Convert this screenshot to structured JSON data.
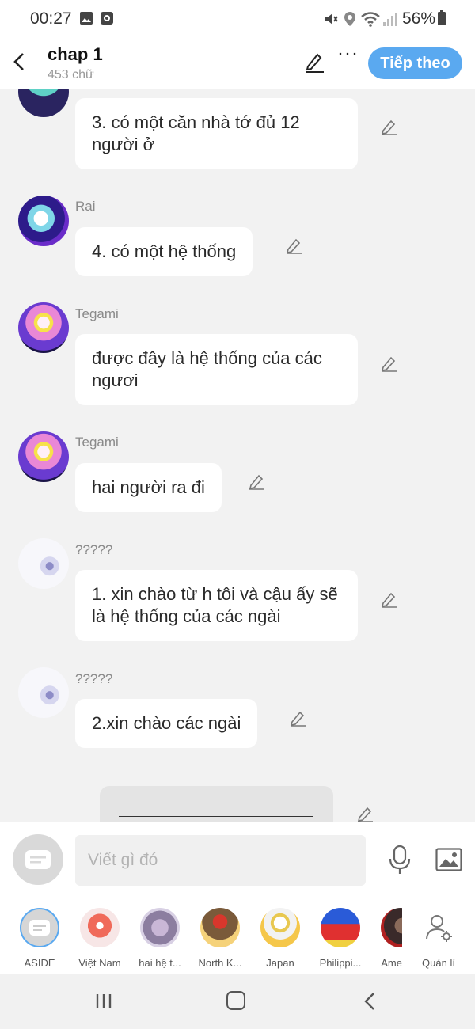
{
  "status_bar": {
    "time": "00:27",
    "battery": "56%"
  },
  "header": {
    "title": "chap 1",
    "word_count": "453 chữ",
    "next_label": "Tiếp theo"
  },
  "messages": [
    {
      "sender": "",
      "text": "3. có một căn nhà tớ đủ 12 người ở"
    },
    {
      "sender": "Rai",
      "text": "4. có một hệ thống"
    },
    {
      "sender": "Tegami",
      "text": "được đây là hệ thống của các ngươi"
    },
    {
      "sender": "Tegami",
      "text": "hai người ra đi"
    },
    {
      "sender": "?????",
      "text": "1. xin chào từ h tôi và cậu ấy sẽ là hệ thống của các ngài"
    },
    {
      "sender": "?????",
      "text": "2.xin chào các ngài"
    }
  ],
  "composer": {
    "placeholder": "Viết gì đó"
  },
  "characters": [
    {
      "label": "ASIDE"
    },
    {
      "label": "Việt Nam"
    },
    {
      "label": "hai hệ t..."
    },
    {
      "label": "North K..."
    },
    {
      "label": "Japan"
    },
    {
      "label": "Philippi..."
    },
    {
      "label": "Ame"
    },
    {
      "label": "Quản lí"
    }
  ],
  "colors": {
    "accent": "#5aa9f0",
    "background": "#f2f2f2",
    "bubble": "#ffffff"
  },
  "icons": [
    "back-arrow-icon",
    "edit-icon",
    "more-icon",
    "pencil-icon",
    "mic-icon",
    "image-icon",
    "manage-icon"
  ]
}
